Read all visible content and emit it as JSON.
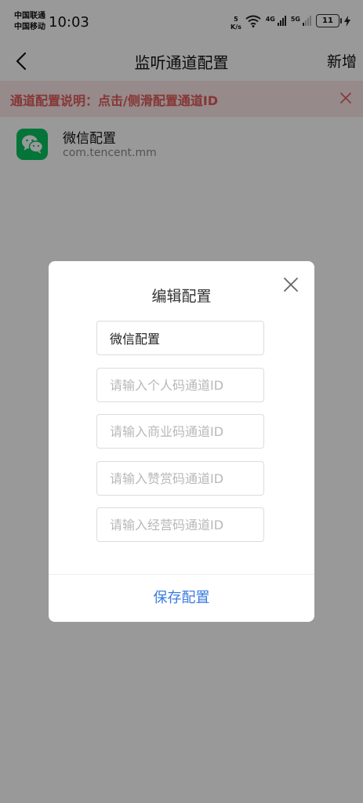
{
  "status_bar": {
    "carrier_1": "中国联通",
    "carrier_2": "中国移动",
    "time": "10:03",
    "net_speed_value": "5",
    "net_speed_unit": "K/s",
    "signal_4g": "4G",
    "signal_5g": "5G",
    "battery": "11"
  },
  "header": {
    "title": "监听通道配置",
    "add_label": "新增"
  },
  "notice": {
    "text": "通道配置说明：点击/侧滑配置通道ID"
  },
  "list": {
    "items": [
      {
        "title": "微信配置",
        "package": "com.tencent.mm"
      }
    ]
  },
  "dialog": {
    "title": "编辑配置",
    "name_value": "微信配置",
    "personal_placeholder": "请输入个人码通道ID",
    "business_placeholder": "请输入商业码通道ID",
    "reward_placeholder": "请输入赞赏码通道ID",
    "merchant_placeholder": "请输入经营码通道ID",
    "save_label": "保存配置"
  },
  "colors": {
    "accent": "#3a7be0",
    "notice_text": "#e05a5a",
    "notice_bg": "#fbe7e7",
    "wechat_green": "#07c160"
  }
}
